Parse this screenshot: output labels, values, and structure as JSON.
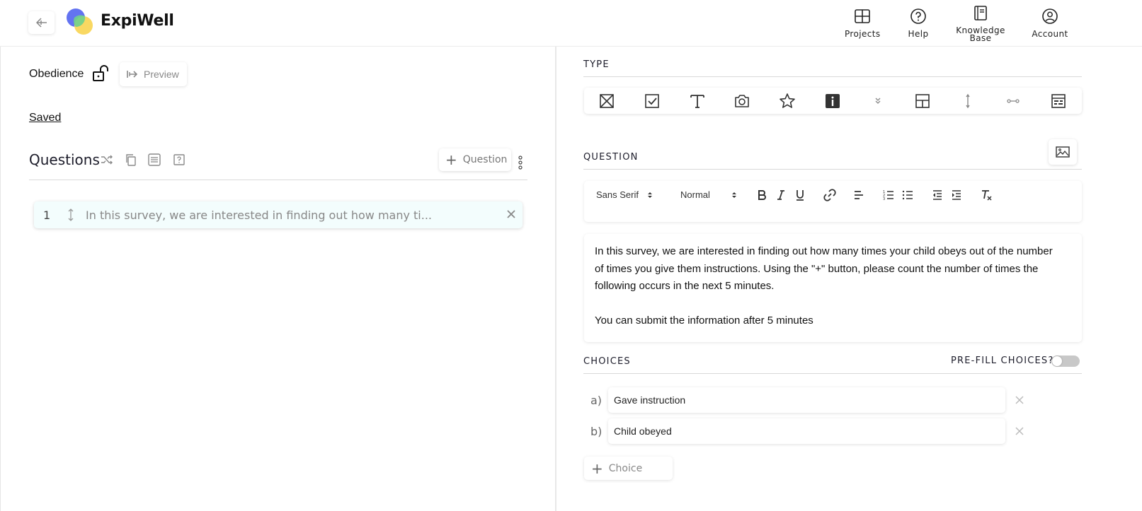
{
  "header": {
    "brand": "ExpiWell",
    "nav": {
      "projects": "Projects",
      "help": "Help",
      "knowledge_line1": "Knowledge",
      "knowledge_line2": "Base",
      "account": "Account"
    }
  },
  "left": {
    "survey_name": "Obedience",
    "preview_label": "Preview",
    "saved_label": "Saved",
    "questions_title": "Questions",
    "add_question_label": "Question",
    "questions": [
      {
        "number": "1",
        "text": "In this survey, we are interested in finding out how many ti..."
      }
    ]
  },
  "right": {
    "type_label": "TYPE",
    "type_icons": [
      "multiple-choice",
      "checkbox",
      "text",
      "camera",
      "star-rating",
      "info",
      "dropdown",
      "grid",
      "vertical-slider",
      "horizontal-slider",
      "table"
    ],
    "question_label": "QUESTION",
    "toolbar": {
      "font": "Sans Serif",
      "size": "Normal"
    },
    "question_text": {
      "line1": "In this survey, we are interested in finding out how many times your child obeys out of the number",
      "line2": "of times you give them instructions. Using the \"+\" button, please count the number of times the",
      "line3": "following occurs in the next 5 minutes.",
      "line4": "You can submit the information after 5 minutes"
    },
    "choices_label": "CHOICES",
    "prefill_label": "PRE-FILL CHOICES?",
    "prefill_enabled": false,
    "choices": [
      {
        "letter": "a)",
        "value": "Gave instruction"
      },
      {
        "letter": "b)",
        "value": "Child obeyed"
      }
    ],
    "add_choice_label": "Choice"
  },
  "colors": {
    "question_row_bg": "#f3fdfd",
    "logo_blue": "#5b6cf0",
    "logo_green": "#6fd08c",
    "logo_yellow": "#f9d65a"
  }
}
